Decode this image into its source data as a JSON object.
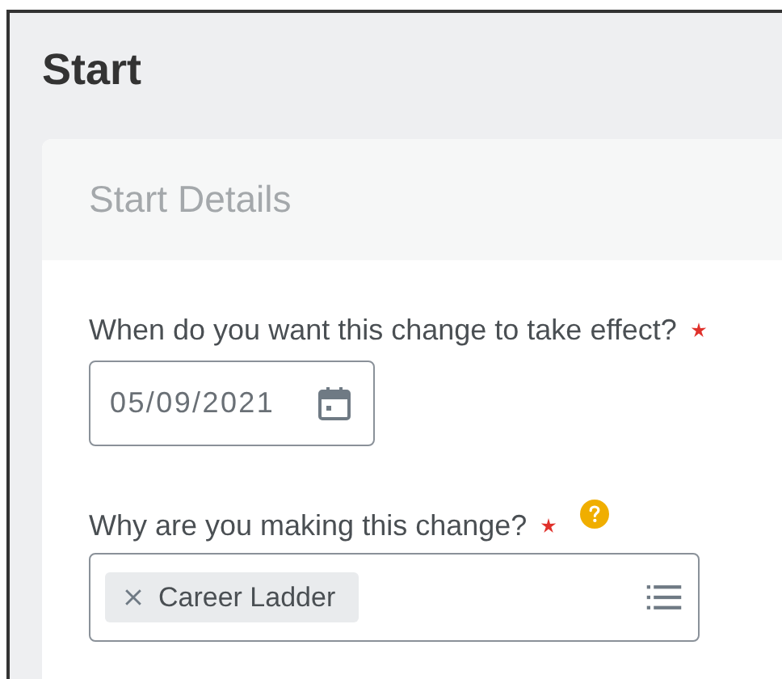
{
  "page": {
    "title": "Start"
  },
  "section": {
    "title": "Start Details"
  },
  "fields": [
    {
      "kind": "date",
      "label": "When do you want this change to take effect?",
      "required": true,
      "value": "05/09/2021"
    },
    {
      "kind": "multiselect",
      "label": "Why are you making this change?",
      "required": true,
      "help": true,
      "chips": [
        "Career Ladder"
      ]
    }
  ]
}
